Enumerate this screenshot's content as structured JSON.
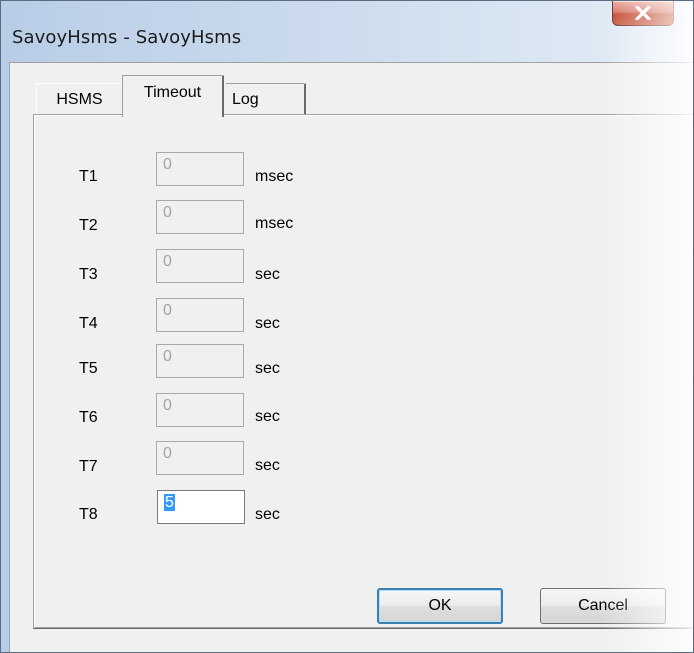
{
  "window": {
    "title": "SavoyHsms - SavoyHsms"
  },
  "titlebar": {
    "close_icon": "close-icon"
  },
  "tabs": [
    {
      "label": "HSMS",
      "selected": false
    },
    {
      "label": "Timeout",
      "selected": true
    },
    {
      "label": "Log",
      "selected": false
    }
  ],
  "timeouts": [
    {
      "label": "T1",
      "value": "0",
      "unit": "msec",
      "enabled": false
    },
    {
      "label": "T2",
      "value": "0",
      "unit": "msec",
      "enabled": false
    },
    {
      "label": "T3",
      "value": "0",
      "unit": "sec",
      "enabled": false
    },
    {
      "label": "T4",
      "value": "0",
      "unit": "sec",
      "enabled": false
    },
    {
      "label": "T5",
      "value": "0",
      "unit": "sec",
      "enabled": false
    },
    {
      "label": "T6",
      "value": "0",
      "unit": "sec",
      "enabled": false
    },
    {
      "label": "T7",
      "value": "0",
      "unit": "sec",
      "enabled": false
    },
    {
      "label": "T8",
      "value": "5",
      "unit": "sec",
      "enabled": true
    }
  ],
  "buttons": {
    "ok": "OK",
    "cancel": "Cancel"
  },
  "colors": {
    "selection_highlight": "#3399ff",
    "close_button": "#c7432b",
    "dialog_face": "#f0f0f0"
  }
}
